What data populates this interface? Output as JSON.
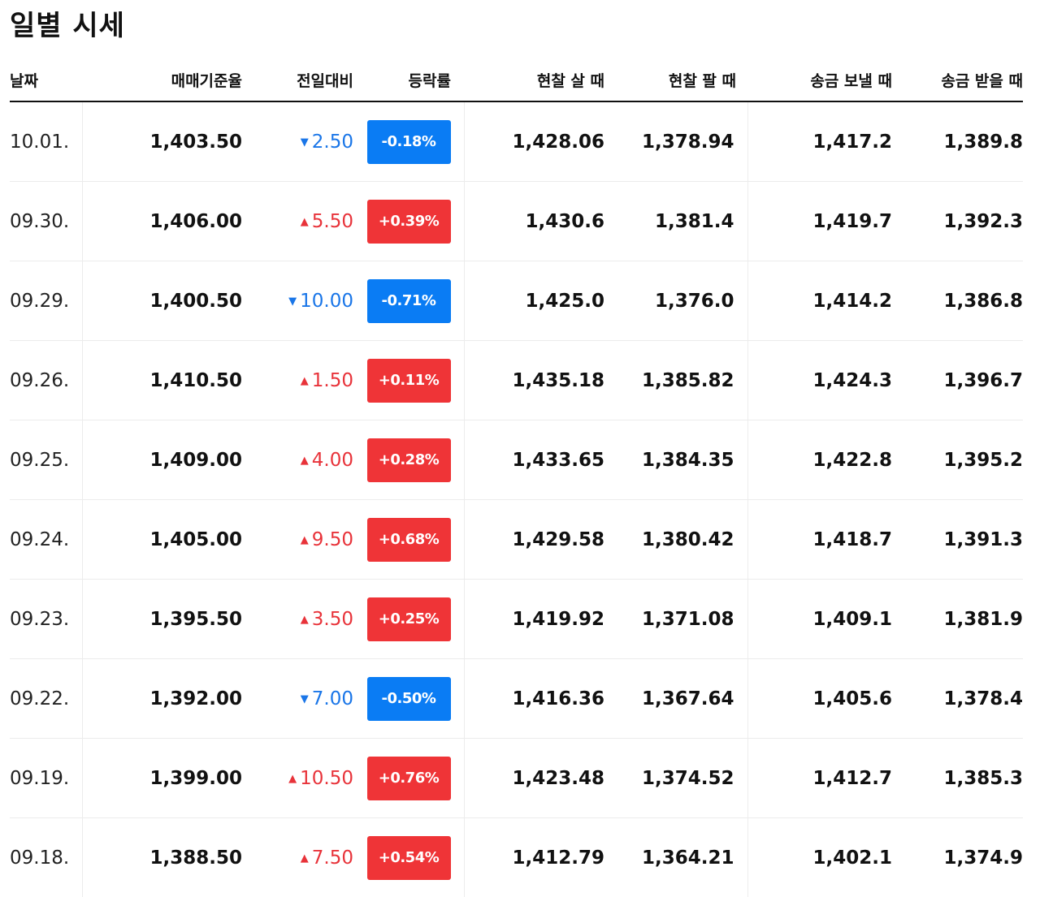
{
  "page": {
    "title": "일별 시세"
  },
  "colors": {
    "up": "#e8333a",
    "down": "#1a76e8",
    "badge_up": "#ef3437",
    "badge_down": "#0a7cf4"
  },
  "table": {
    "headers": {
      "date": "날짜",
      "base_rate": "매매기준율",
      "change": "전일대비",
      "change_rate": "등락률",
      "cash_buy": "현찰 살 때",
      "cash_sell": "현찰 팔 때",
      "send": "송금 보낼 때",
      "receive": "송금 받을 때"
    },
    "rows": [
      {
        "date": "10.01.",
        "base": "1,403.50",
        "dir": "down",
        "change": "2.50",
        "rate": "-0.18%",
        "cash_buy": "1,428.06",
        "cash_sell": "1,378.94",
        "send": "1,417.2",
        "receive": "1,389.8"
      },
      {
        "date": "09.30.",
        "base": "1,406.00",
        "dir": "up",
        "change": "5.50",
        "rate": "+0.39%",
        "cash_buy": "1,430.6",
        "cash_sell": "1,381.4",
        "send": "1,419.7",
        "receive": "1,392.3"
      },
      {
        "date": "09.29.",
        "base": "1,400.50",
        "dir": "down",
        "change": "10.00",
        "rate": "-0.71%",
        "cash_buy": "1,425.0",
        "cash_sell": "1,376.0",
        "send": "1,414.2",
        "receive": "1,386.8"
      },
      {
        "date": "09.26.",
        "base": "1,410.50",
        "dir": "up",
        "change": "1.50",
        "rate": "+0.11%",
        "cash_buy": "1,435.18",
        "cash_sell": "1,385.82",
        "send": "1,424.3",
        "receive": "1,396.7"
      },
      {
        "date": "09.25.",
        "base": "1,409.00",
        "dir": "up",
        "change": "4.00",
        "rate": "+0.28%",
        "cash_buy": "1,433.65",
        "cash_sell": "1,384.35",
        "send": "1,422.8",
        "receive": "1,395.2"
      },
      {
        "date": "09.24.",
        "base": "1,405.00",
        "dir": "up",
        "change": "9.50",
        "rate": "+0.68%",
        "cash_buy": "1,429.58",
        "cash_sell": "1,380.42",
        "send": "1,418.7",
        "receive": "1,391.3"
      },
      {
        "date": "09.23.",
        "base": "1,395.50",
        "dir": "up",
        "change": "3.50",
        "rate": "+0.25%",
        "cash_buy": "1,419.92",
        "cash_sell": "1,371.08",
        "send": "1,409.1",
        "receive": "1,381.9"
      },
      {
        "date": "09.22.",
        "base": "1,392.00",
        "dir": "down",
        "change": "7.00",
        "rate": "-0.50%",
        "cash_buy": "1,416.36",
        "cash_sell": "1,367.64",
        "send": "1,405.6",
        "receive": "1,378.4"
      },
      {
        "date": "09.19.",
        "base": "1,399.00",
        "dir": "up",
        "change": "10.50",
        "rate": "+0.76%",
        "cash_buy": "1,423.48",
        "cash_sell": "1,374.52",
        "send": "1,412.7",
        "receive": "1,385.3"
      },
      {
        "date": "09.18.",
        "base": "1,388.50",
        "dir": "up",
        "change": "7.50",
        "rate": "+0.54%",
        "cash_buy": "1,412.79",
        "cash_sell": "1,364.21",
        "send": "1,402.1",
        "receive": "1,374.9"
      }
    ]
  }
}
